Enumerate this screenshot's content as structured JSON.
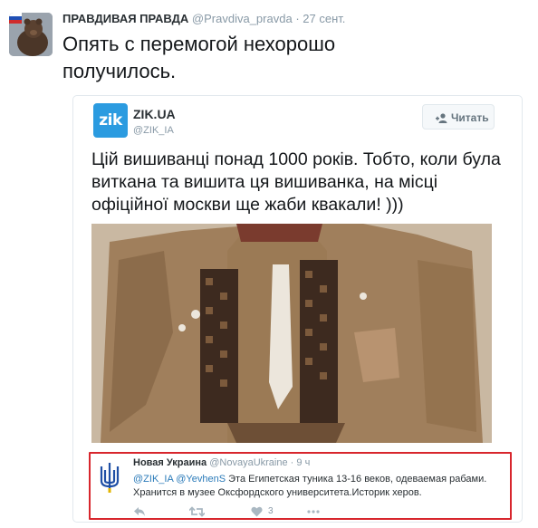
{
  "tweet": {
    "author_name": "ПРАВДИВАЯ ПРАВДА",
    "handle": "@Pravdiva_pravda",
    "separator": "·",
    "time": "27 сент.",
    "text": "Опять с перемогой нехорошо получилось."
  },
  "card": {
    "account_name": "ZIK.UA",
    "account_handle": "@ZIK_IA",
    "logo_text": "zik",
    "follow_label": "Читать",
    "text": "Цій вишиванці понад 1000 років. Тобто, коли була виткана та вишита ця вишиванка, на місці офіційної москви ще жаби квакали! )))"
  },
  "quoted": {
    "author_name": "Новая Украина",
    "handle": "@NovayaUkraine",
    "separator": "·",
    "time": "9 ч",
    "mention_1": "@ZIK_IA",
    "mention_2": "@YevhenS",
    "text_rest": " Эта Египетская туника 13-16 веков, одеваемая рабами. Хранится в музее Оксфордского университета.Историк херов.",
    "likes_count": "3"
  },
  "colors": {
    "accent": "#2b7bb9",
    "zik_brand": "#2b9be0",
    "highlight_border": "#d8262d"
  }
}
